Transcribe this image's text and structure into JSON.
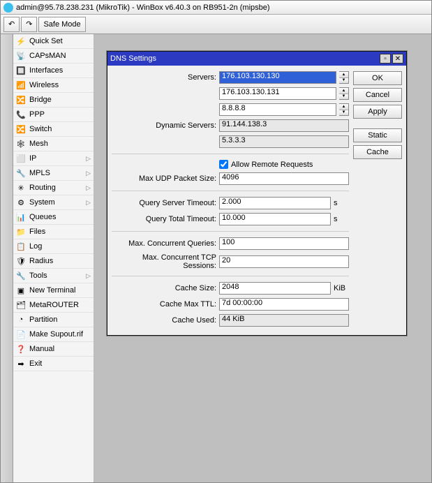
{
  "window": {
    "title": "admin@95.78.238.231 (MikroTik) - WinBox v6.40.3 on RB951-2n (mipsbe)"
  },
  "toolbar": {
    "safe_mode": "Safe Mode"
  },
  "sidebar": {
    "items": [
      {
        "label": "Quick Set",
        "has_sub": false
      },
      {
        "label": "CAPsMAN",
        "has_sub": false
      },
      {
        "label": "Interfaces",
        "has_sub": false
      },
      {
        "label": "Wireless",
        "has_sub": false
      },
      {
        "label": "Bridge",
        "has_sub": false
      },
      {
        "label": "PPP",
        "has_sub": false
      },
      {
        "label": "Switch",
        "has_sub": false
      },
      {
        "label": "Mesh",
        "has_sub": false
      },
      {
        "label": "IP",
        "has_sub": true
      },
      {
        "label": "MPLS",
        "has_sub": true
      },
      {
        "label": "Routing",
        "has_sub": true
      },
      {
        "label": "System",
        "has_sub": true
      },
      {
        "label": "Queues",
        "has_sub": false
      },
      {
        "label": "Files",
        "has_sub": false
      },
      {
        "label": "Log",
        "has_sub": false
      },
      {
        "label": "Radius",
        "has_sub": false
      },
      {
        "label": "Tools",
        "has_sub": true
      },
      {
        "label": "New Terminal",
        "has_sub": false
      },
      {
        "label": "MetaROUTER",
        "has_sub": false
      },
      {
        "label": "Partition",
        "has_sub": false
      },
      {
        "label": "Make Supout.rif",
        "has_sub": false
      },
      {
        "label": "Manual",
        "has_sub": false
      },
      {
        "label": "Exit",
        "has_sub": false
      }
    ]
  },
  "dialog": {
    "title": "DNS Settings",
    "labels": {
      "servers": "Servers:",
      "dynamic_servers": "Dynamic Servers:",
      "allow_remote": "Allow Remote Requests",
      "max_udp": "Max UDP Packet Size:",
      "query_server_timeout": "Query Server Timeout:",
      "query_total_timeout": "Query Total Timeout:",
      "max_concurrent_queries": "Max. Concurrent Queries:",
      "max_concurrent_tcp": "Max. Concurrent TCP Sessions:",
      "cache_size": "Cache Size:",
      "cache_max_ttl": "Cache Max TTL:",
      "cache_used": "Cache Used:",
      "unit_s": "s",
      "unit_kib": "KiB"
    },
    "values": {
      "server1": "176.103.130.130",
      "server2": "176.103.130.131",
      "server3": "8.8.8.8",
      "dyn1": "91.144.138.3",
      "dyn2": "5.3.3.3",
      "allow_remote_checked": true,
      "max_udp": "4096",
      "query_server_timeout": "2.000",
      "query_total_timeout": "10.000",
      "max_concurrent_queries": "100",
      "max_concurrent_tcp": "20",
      "cache_size": "2048",
      "cache_max_ttl": "7d 00:00:00",
      "cache_used": "44 KiB"
    },
    "buttons": {
      "ok": "OK",
      "cancel": "Cancel",
      "apply": "Apply",
      "static": "Static",
      "cache": "Cache"
    }
  }
}
